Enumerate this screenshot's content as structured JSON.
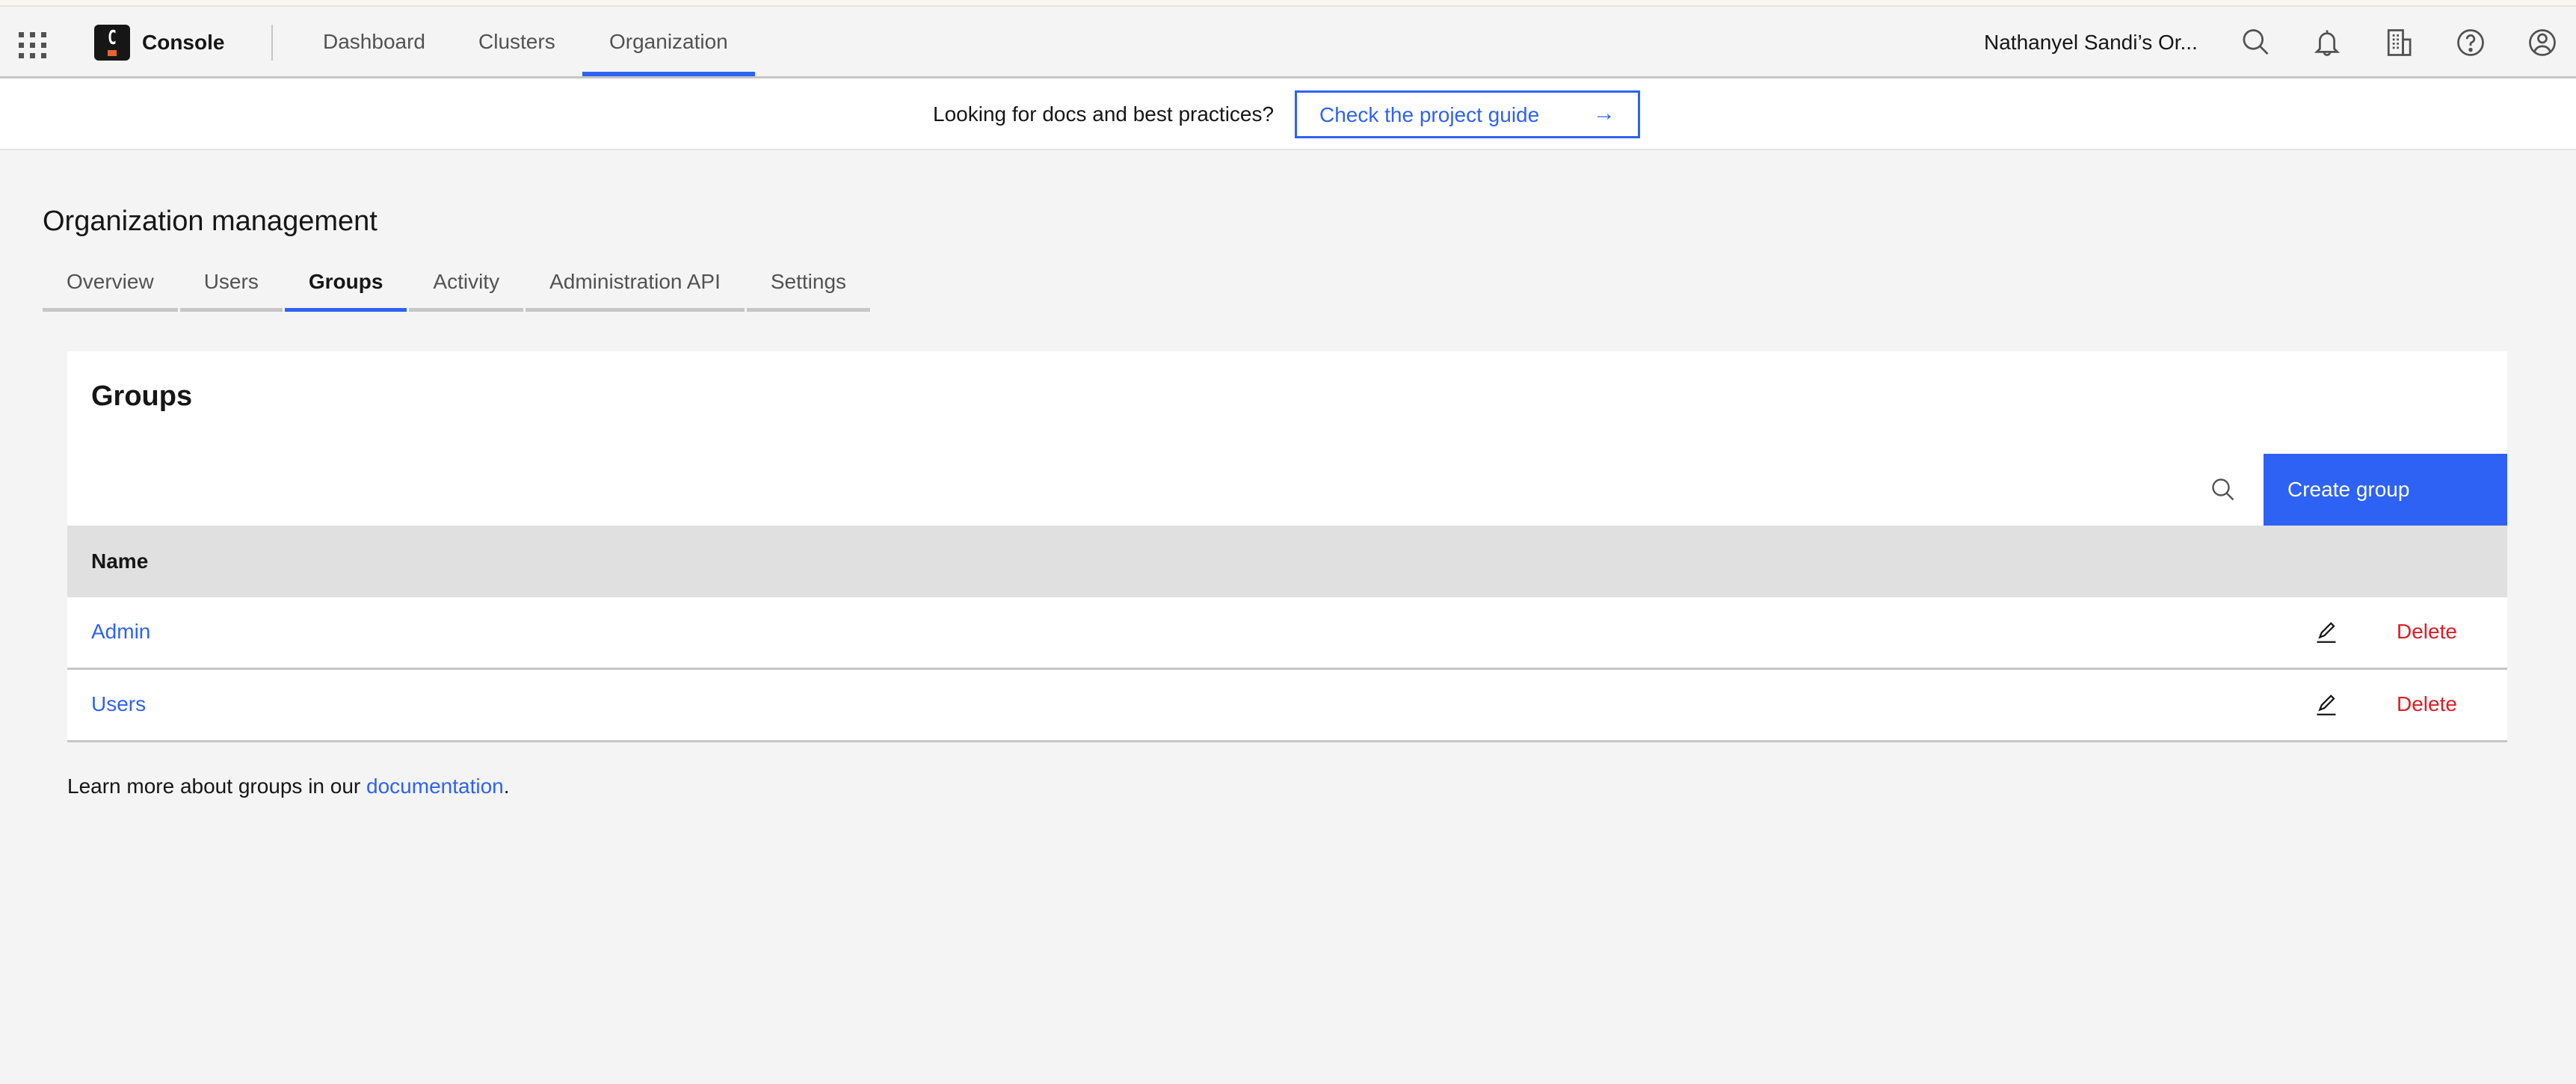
{
  "header": {
    "app_name": "Console",
    "logo_letter": "C",
    "nav": [
      {
        "label": "Dashboard",
        "active": false
      },
      {
        "label": "Clusters",
        "active": false
      },
      {
        "label": "Organization",
        "active": true
      }
    ],
    "org_name": "Nathanyel Sandi’s Or...",
    "icons": [
      "search-icon",
      "notification-bell-icon",
      "building-icon",
      "help-icon",
      "user-avatar-icon"
    ]
  },
  "banner": {
    "text": "Looking for docs and best practices?",
    "button_label": "Check the project guide",
    "button_icon": "→"
  },
  "page": {
    "title": "Organization management",
    "tabs": [
      {
        "label": "Overview",
        "active": false
      },
      {
        "label": "Users",
        "active": false
      },
      {
        "label": "Groups",
        "active": true
      },
      {
        "label": "Activity",
        "active": false
      },
      {
        "label": "Administration API",
        "active": false
      },
      {
        "label": "Settings",
        "active": false
      }
    ]
  },
  "groups_card": {
    "title": "Groups",
    "create_button": "Create group",
    "columns": [
      "Name"
    ],
    "rows": [
      {
        "name": "Admin",
        "delete_label": "Delete"
      },
      {
        "name": "Users",
        "delete_label": "Delete"
      }
    ]
  },
  "footer": {
    "prefix": "Learn more about groups in our ",
    "link": "documentation",
    "suffix": "."
  },
  "colors": {
    "accent": "#2e62f4",
    "danger": "#da1e28",
    "logo_accent": "#e8652c",
    "background": "#f4f4f4"
  }
}
